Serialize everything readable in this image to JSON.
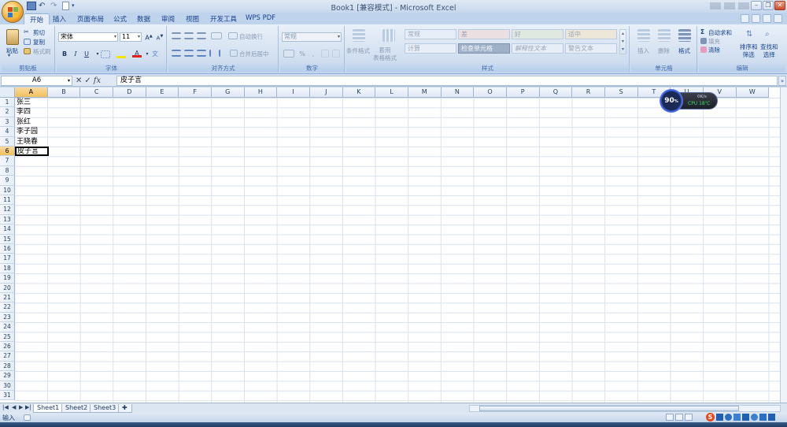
{
  "window": {
    "title": "Book1  [兼容模式] - Microsoft Excel"
  },
  "tabs": [
    "开始",
    "插入",
    "页面布局",
    "公式",
    "数据",
    "审阅",
    "视图",
    "开发工具",
    "WPS PDF"
  ],
  "ribbon": {
    "clipboard": {
      "label": "剪贴板",
      "paste": "粘贴",
      "cut": "剪切",
      "copy": "复制",
      "format_painter": "格式刷"
    },
    "font": {
      "label": "字体",
      "font_name": "宋体",
      "font_size": "11",
      "bold": "B",
      "italic": "I",
      "underline": "U"
    },
    "alignment": {
      "label": "对齐方式",
      "wrap_text": "自动换行",
      "merge_center": "合并后居中"
    },
    "number": {
      "label": "数字",
      "format": "常规"
    },
    "styles": {
      "label": "样式",
      "conditional_formatting": "条件格式",
      "format_as_table": "套用\n表格格式",
      "cells": [
        "常规",
        "差",
        "好",
        "适中",
        "计算",
        "检查单元格",
        "解释性文本",
        "警告文本"
      ]
    },
    "cells": {
      "label": "单元格",
      "insert": "插入",
      "delete": "删除",
      "format": "格式"
    },
    "editing": {
      "label": "编辑",
      "autosum": "自动求和",
      "fill": "填充",
      "clear": "清除",
      "sort_filter": "排序和\n筛选",
      "find_select": "查找和\n选择"
    }
  },
  "formula_bar": {
    "name_box": "A6",
    "formula": "皮子言"
  },
  "grid": {
    "columns": [
      "A",
      "B",
      "C",
      "D",
      "E",
      "F",
      "G",
      "H",
      "I",
      "J",
      "K",
      "L",
      "M",
      "N",
      "O",
      "P",
      "Q",
      "R",
      "S",
      "T",
      "U",
      "V",
      "W"
    ],
    "rows": [
      "1",
      "2",
      "3",
      "4",
      "5",
      "6",
      "7",
      "8",
      "9",
      "10",
      "11",
      "12",
      "13",
      "14",
      "15",
      "16",
      "17",
      "18",
      "19",
      "20",
      "21",
      "22",
      "23",
      "24",
      "25",
      "26",
      "27",
      "28",
      "29",
      "30",
      "31"
    ],
    "active_cell": "A6",
    "cells_A": [
      "张三",
      "李四",
      "张红",
      "李子园",
      "王晓春",
      "皮子言"
    ]
  },
  "speed_widget": {
    "percent": "90",
    "unit": "%",
    "net": "0K/s",
    "cpu": "CPU 18℃"
  },
  "sheets": [
    "Sheet1",
    "Sheet2",
    "Sheet3"
  ],
  "status": {
    "mode": "输入"
  },
  "icons": {
    "office": "office-logo-icon",
    "ime": "sogou-ime-icon"
  },
  "colors": {
    "ribbon_bg": "#d1dff0",
    "active_header": "#f1c05f",
    "text_blue": "#15428b"
  }
}
